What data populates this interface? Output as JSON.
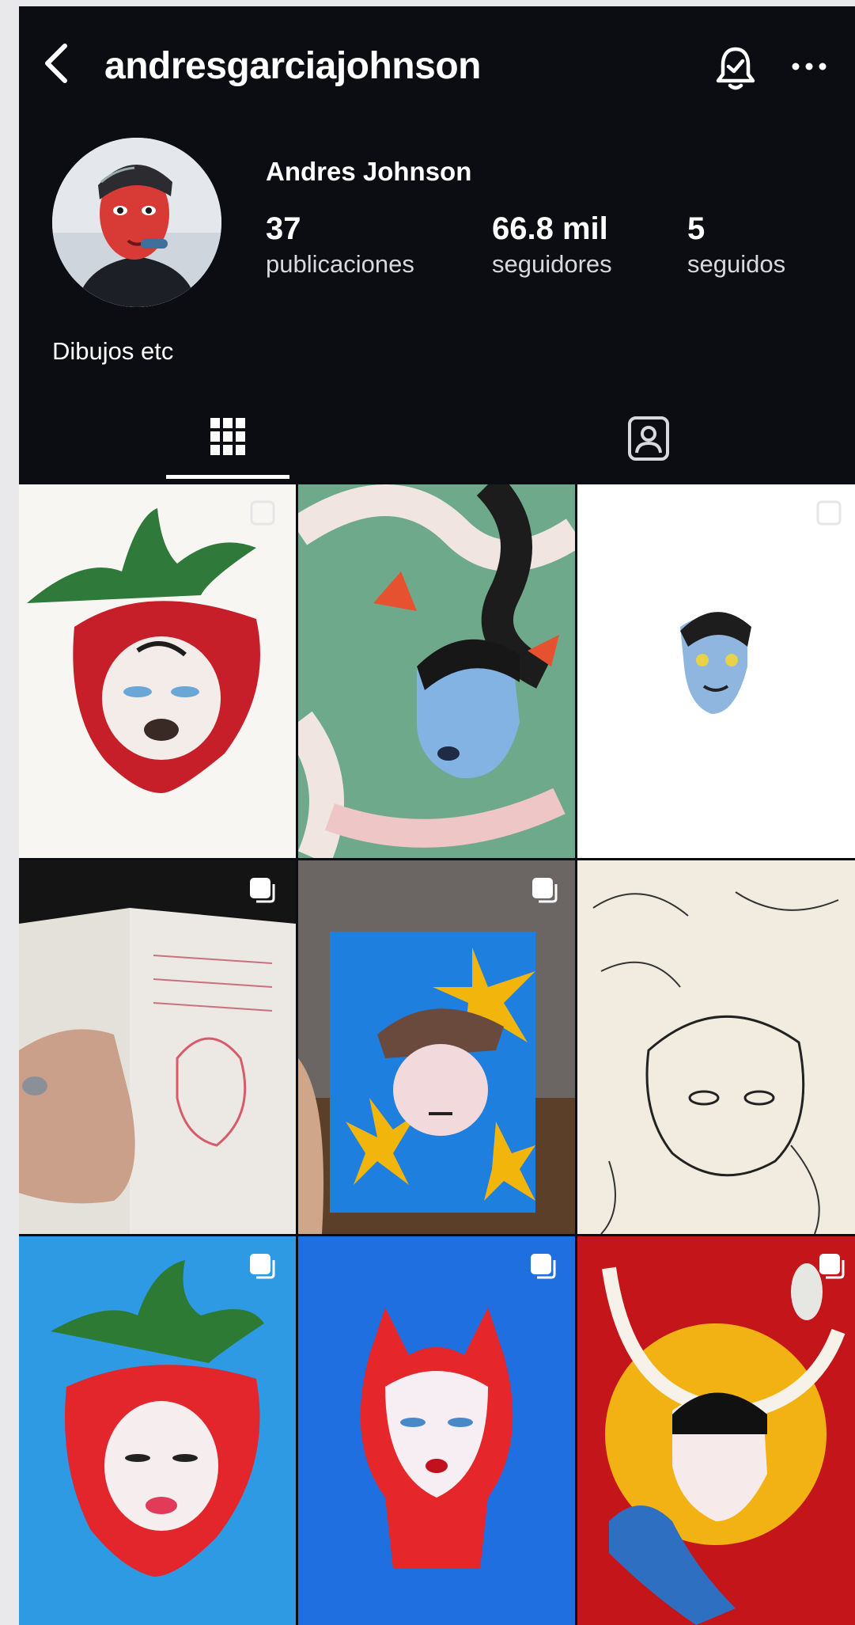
{
  "header": {
    "username": "andresgarciajohnson",
    "icons": [
      "back-icon",
      "bell-icon",
      "more-icon"
    ]
  },
  "profile": {
    "name": "Andres Johnson",
    "stats": [
      {
        "value": "37",
        "label": "publicaciones"
      },
      {
        "value": "66.8 mil",
        "label": "seguidores"
      },
      {
        "value": "5",
        "label": "seguidos"
      }
    ],
    "bio": "Dibujos etc"
  },
  "tabs": {
    "selected": "grid",
    "items": [
      "grid-icon",
      "tagged-person-icon"
    ]
  },
  "colors": {
    "background": "#0b0d12",
    "text": "#ffffff",
    "muted_text": "#d7d9dd"
  }
}
